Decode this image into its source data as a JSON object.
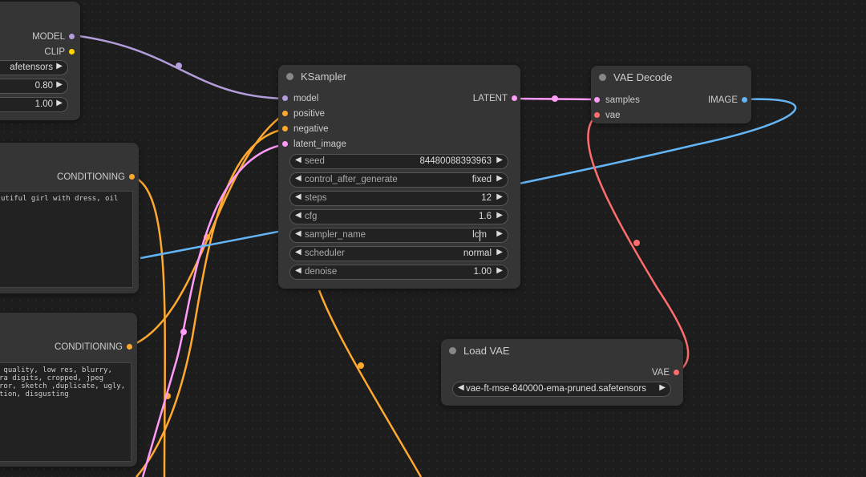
{
  "colors": {
    "model": "#b39ddb",
    "clip": "#ffd500",
    "conditioning": "#ffa931",
    "latent": "#ff9cf9",
    "image": "#64b5f6",
    "vae": "#ff6e6e"
  },
  "checkpoint_node": {
    "outputs": [
      "MODEL",
      "CLIP"
    ],
    "widgets": [
      {
        "value": "afetensors"
      },
      {
        "value": "0.80"
      },
      {
        "value": "1.00"
      }
    ]
  },
  "positive_prompt_node": {
    "output": "CONDITIONING",
    "text": "utiful girl with dress, oil"
  },
  "negative_prompt_node": {
    "title": ")",
    "output": "CONDITIONING",
    "text": " quality, low res, blurry,\nra digits, cropped, jpeg\nror, sketch ,duplicate, ugly,\ntion, disgusting"
  },
  "ksampler": {
    "title": "KSampler",
    "inputs": [
      "model",
      "positive",
      "negative",
      "latent_image"
    ],
    "output": "LATENT",
    "widgets": [
      {
        "label": "seed",
        "value": "84480088393963"
      },
      {
        "label": "control_after_generate",
        "value": "fixed"
      },
      {
        "label": "steps",
        "value": "12"
      },
      {
        "label": "cfg",
        "value": "1.6"
      },
      {
        "label": "sampler_name",
        "value": "lcm"
      },
      {
        "label": "scheduler",
        "value": "normal"
      },
      {
        "label": "denoise",
        "value": "1.00"
      }
    ]
  },
  "vae_decode": {
    "title": "VAE Decode",
    "inputs": [
      "samples",
      "vae"
    ],
    "output": "IMAGE"
  },
  "load_vae": {
    "title": "Load VAE",
    "output": "VAE",
    "vae_name": "vae-ft-mse-840000-ema-pruned.safetensors"
  }
}
